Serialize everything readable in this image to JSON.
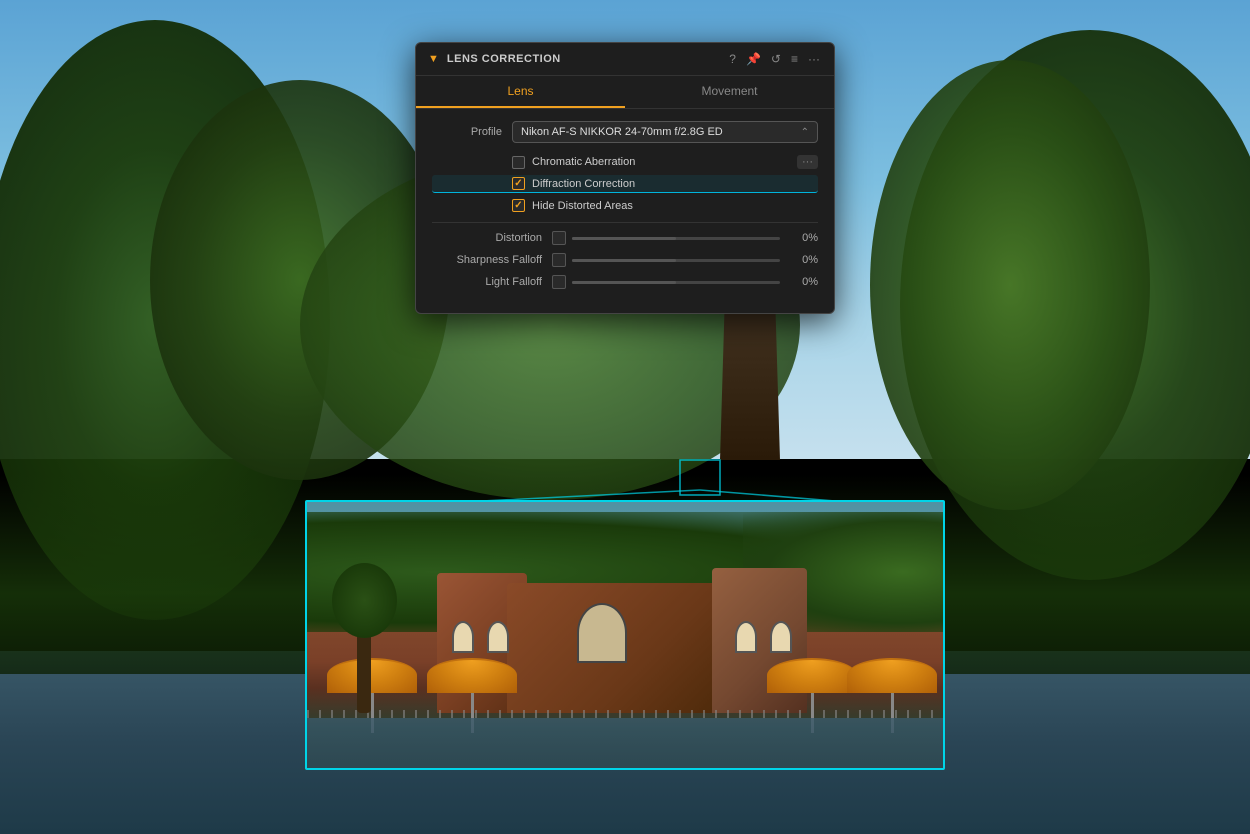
{
  "panel": {
    "title": "LENS CORRECTION",
    "tabs": [
      {
        "id": "lens",
        "label": "Lens",
        "active": true
      },
      {
        "id": "movement",
        "label": "Movement",
        "active": false
      }
    ],
    "profile": {
      "label": "Profile",
      "value": "Nikon AF-S NIKKOR 24-70mm f/2.8G ED"
    },
    "checkboxes": [
      {
        "id": "chromatic-aberration",
        "label": "Chromatic Aberration",
        "checked": false,
        "highlighted": false,
        "hasMoreBtn": true,
        "moreBtnLabel": "···"
      },
      {
        "id": "diffraction-correction",
        "label": "Diffraction Correction",
        "checked": true,
        "highlighted": true,
        "hasMoreBtn": false
      },
      {
        "id": "hide-distorted-areas",
        "label": "Hide Distorted Areas",
        "checked": true,
        "highlighted": false,
        "hasMoreBtn": false
      }
    ],
    "sliders": [
      {
        "id": "distortion",
        "label": "Distortion",
        "value": 0,
        "valueLabel": "0%"
      },
      {
        "id": "sharpness-falloff",
        "label": "Sharpness Falloff",
        "value": 0,
        "valueLabel": "0%"
      },
      {
        "id": "light-falloff",
        "label": "Light Falloff",
        "value": 0,
        "valueLabel": "0%"
      }
    ],
    "icons": {
      "question": "?",
      "pin": "📌",
      "undo": "↺",
      "list": "≡",
      "more": "···",
      "collapse": "▼"
    }
  },
  "preview": {
    "border_color": "#00d4e8"
  }
}
